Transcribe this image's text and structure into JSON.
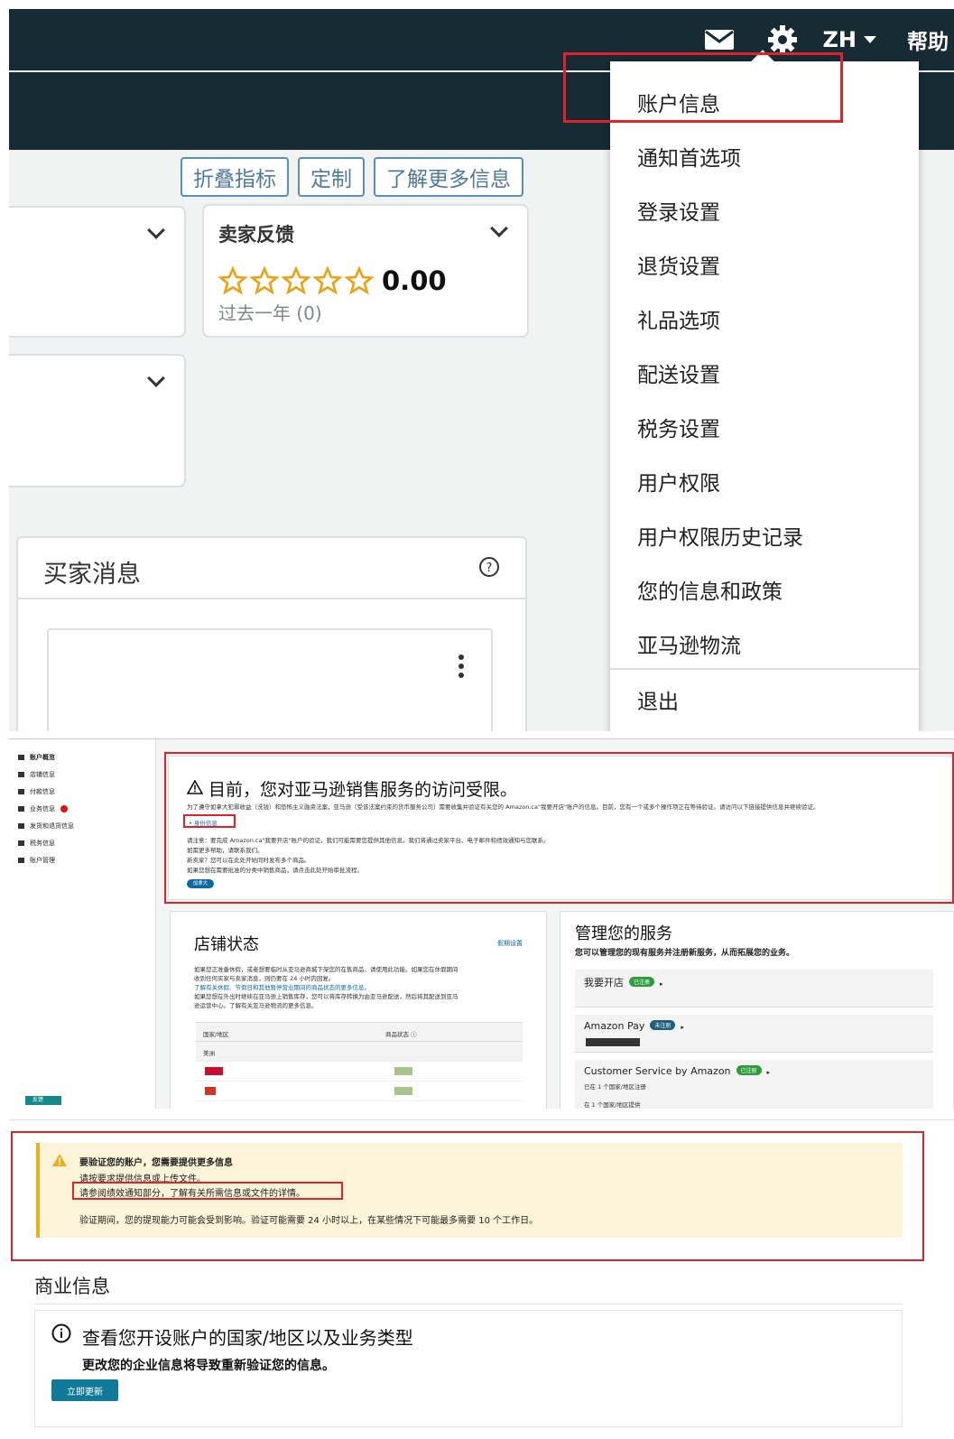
{
  "colors": {
    "header_bg": "#162b34",
    "highlight_red": "#e0232b",
    "link_blue": "#0a6aa1",
    "star": "#e8a317"
  },
  "header": {
    "language": "ZH",
    "help": "帮助"
  },
  "toolbar": {
    "collapse_label": "折叠指标",
    "customize_label": "定制",
    "learn_more_label": "了解更多信息"
  },
  "feedback": {
    "title": "卖家反馈",
    "rating": "0.00",
    "period": "过去一年 (0)",
    "stars": 0,
    "max_stars": 5
  },
  "buyer_messages": {
    "title": "买家消息"
  },
  "menu": {
    "items": [
      "账户信息",
      "通知首选项",
      "登录设置",
      "退货设置",
      "礼品选项",
      "配送设置",
      "税务设置",
      "用户权限",
      "用户权限历史记录",
      "您的信息和政策",
      "亚马逊物流"
    ],
    "logout": "退出"
  },
  "sidebar": {
    "items": [
      "账户概览",
      "店铺信息",
      "付款信息",
      "业务信息",
      "发货和退货信息",
      "税务信息",
      "账户管理"
    ],
    "feedback_label": "反馈"
  },
  "notice": {
    "title": "目前，您对亚马逊销售服务的访问受限。",
    "line1": "为了遵守如拿大犯罪收益（洗钱）和恐怖主义融资法案，亚马逊（受该法案约束的货币服务公司）需要收集并验证有关您的 Amazon.ca\"我要开店\"账户的信息。目前，您有一个或多个操作项正在等待验证。请访问以下链接提供信息并继续验证。",
    "item": "• 身份信息",
    "line2": "请注意：要完成 Amazon.ca\"我要开店\"账户的验证，我们可能需要您提供其他信息。我们将通过卖家平台、电子邮件和绩效通知与您联系。",
    "line3": "如需更多帮助，请联系我们。",
    "line4": "新卖家？您可以在此处开始同时发布多个商品。",
    "line5": "如果您想在需要批准的分类中销售商品，请点击此处开始审批流程。",
    "pill": "加拿大"
  },
  "store": {
    "title": "店铺状态",
    "link": "假期设置",
    "p1": "如果您正准备休假，或者想要临时从亚马逊商城下架您的在售商品，请使用此功能。如果您在休假期间",
    "p2": "收到任何买家与卖家消息，则仍要在 24 小时内回复。",
    "p3": "了解有关休假、节假日和其他暂停营业期间的商品状态的更多信息。",
    "p4": "如果您想在外出时继续在亚马逊上销售库存，您可以将库存转换为由亚马逊配送，然后将其配送到亚马",
    "p5": "逊运营中心。了解有关亚马逊物流的更多信息。",
    "col1": "国家/地区",
    "col2": "商品状态 ⓘ",
    "region": "美洲"
  },
  "services": {
    "title": "管理您的服务",
    "subtitle": "您可以管理您的现有服务并注册新服务，从而拓展您的业务。",
    "items": [
      {
        "name": "我要开店",
        "badge": "已注册",
        "badge_color": "#2c9d3a"
      },
      {
        "name": "Amazon Pay",
        "badge": "未注册",
        "badge_color": "#1f5e7d"
      },
      {
        "name": "Customer Service by Amazon",
        "badge": "已注册",
        "badge_color": "#2c9d3a",
        "detail1": "已在 1 个国家/地区注册",
        "detail2": "在 1 个国家/地区提供"
      }
    ]
  },
  "verification": {
    "title": "要验证您的账户，您需要提供更多信息",
    "line1": "请按要求提供信息或上传文件。",
    "line2": "请参阅绩效通知部分，了解有关所需信息或文件的详情。",
    "line3": "验证期间，您的提现能力可能会受到影响。验证可能需要 24 小时以上，在某些情况下可能最多需要 10 个工作日。"
  },
  "business": {
    "title": "商业信息",
    "question": "查看您开设账户的国家/地区以及业务类型",
    "warning": "更改您的企业信息将导致重新验证您的信息。",
    "update_button": "立即更新"
  }
}
